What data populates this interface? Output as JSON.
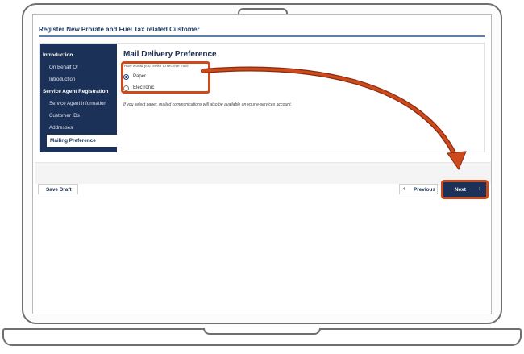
{
  "app": {
    "title": "Register New Prorate and Fuel Tax related Customer"
  },
  "sidebar": {
    "sections": [
      {
        "label": "Introduction",
        "items": [
          "On Behalf Of",
          "Introduction"
        ]
      },
      {
        "label": "Service Agent Registration",
        "items": [
          "Service Agent Information",
          "Customer IDs",
          "Addresses"
        ]
      }
    ],
    "active_item": "Mailing Preference"
  },
  "form": {
    "title": "Mail Delivery Preference",
    "question": "How would you prefer to receive mail?",
    "options": [
      {
        "label": "Paper",
        "selected": true
      },
      {
        "label": "Electronic",
        "selected": false
      }
    ],
    "note": "If you select paper, mailed communications will also be available on your e-services account."
  },
  "footer": {
    "save_draft": "Save Draft",
    "previous": "Previous",
    "next": "Next"
  },
  "colors": {
    "navy": "#1c3157",
    "highlight": "#cc4a1c"
  },
  "icons": {
    "previous": "chevron-left-icon",
    "next": "chevron-right-icon",
    "radio_selected": "radio-checked-icon"
  }
}
